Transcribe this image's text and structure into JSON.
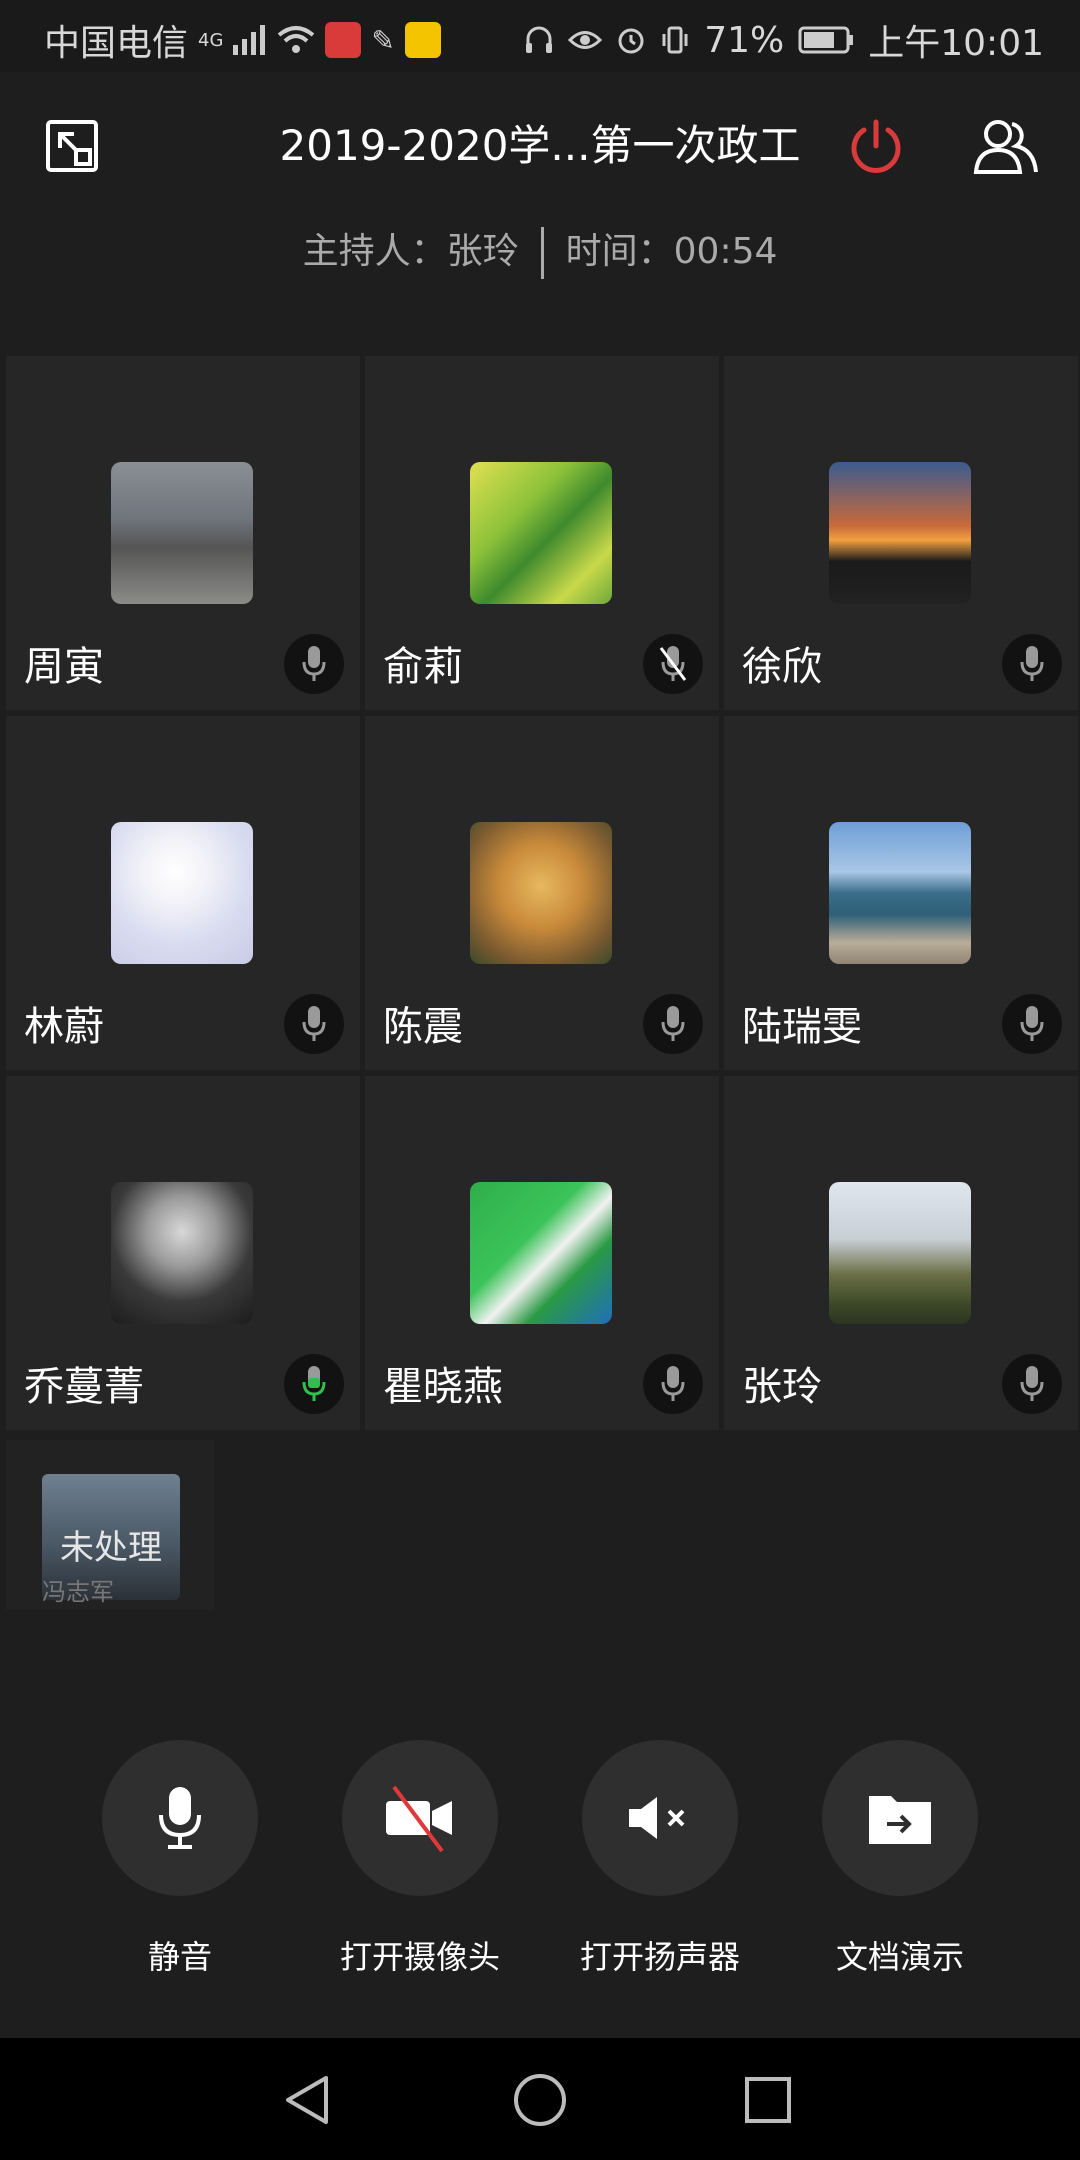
{
  "status_bar": {
    "carrier": "中国电信",
    "network": "4G",
    "battery": "71%",
    "time": "上午10:01"
  },
  "header": {
    "title": "2019-2020学...第一次政工",
    "host_label": "主持人：",
    "host_name": "张玲",
    "time_label": "时间：",
    "time_value": "00:54"
  },
  "participants": [
    {
      "name": "周寅",
      "mic": "on"
    },
    {
      "name": "俞莉",
      "mic": "muted"
    },
    {
      "name": "徐欣",
      "mic": "on"
    },
    {
      "name": "林蔚",
      "mic": "on"
    },
    {
      "name": "陈震",
      "mic": "on"
    },
    {
      "name": "陆瑞雯",
      "mic": "on"
    },
    {
      "name": "乔蔓菁",
      "mic": "speaking"
    },
    {
      "name": "瞿晓燕",
      "mic": "on"
    },
    {
      "name": "张玲",
      "mic": "on"
    }
  ],
  "pending": {
    "status": "未处理",
    "name": "冯志军"
  },
  "controls": [
    {
      "label": "静音",
      "icon": "microphone-icon"
    },
    {
      "label": "打开摄像头",
      "icon": "camera-off-icon"
    },
    {
      "label": "打开扬声器",
      "icon": "speaker-muted-icon"
    },
    {
      "label": "文档演示",
      "icon": "folder-share-icon"
    }
  ],
  "colors": {
    "background": "#1e1e1e",
    "tile": "#262626",
    "power": "#d93a3a",
    "speaking": "#2fbf4f"
  }
}
